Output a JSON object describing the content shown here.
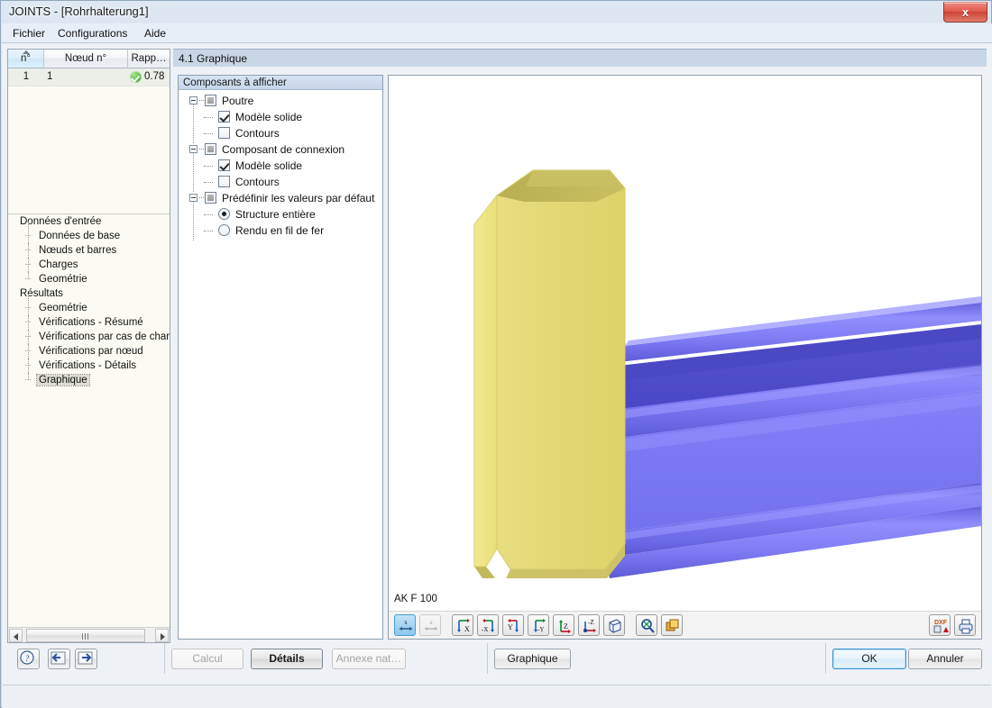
{
  "window": {
    "title": "JOINTS - [Rohrhalterung1]",
    "close_label": "x"
  },
  "menubar": {
    "items": [
      {
        "label": "Fichier"
      },
      {
        "label": "Configurations"
      },
      {
        "label": "Aide"
      }
    ]
  },
  "left_panel": {
    "grid": {
      "columns": [
        "n°",
        "Nœud n°",
        "Rapp…"
      ],
      "rows": [
        {
          "no": "1",
          "node": "1",
          "status": "ok",
          "ratio": "0.78"
        }
      ]
    },
    "nav": {
      "items": [
        {
          "label": "Données d'entrée",
          "level": 0,
          "selected": false
        },
        {
          "label": "Données de base",
          "level": 1,
          "selected": false
        },
        {
          "label": "Nœuds et barres",
          "level": 1,
          "selected": false
        },
        {
          "label": "Charges",
          "level": 1,
          "selected": false
        },
        {
          "label": "Geométrie",
          "level": 1,
          "selected": false
        },
        {
          "label": "Résultats",
          "level": 0,
          "selected": false
        },
        {
          "label": "Geométrie",
          "level": 1,
          "selected": false
        },
        {
          "label": "Vérifications - Résumé",
          "level": 1,
          "selected": false
        },
        {
          "label": "Vérifications par cas de charge",
          "level": 1,
          "selected": false
        },
        {
          "label": "Vérifications par nœud",
          "level": 1,
          "selected": false
        },
        {
          "label": "Vérifications - Détails",
          "level": 1,
          "selected": false
        },
        {
          "label": "Graphique",
          "level": 1,
          "selected": true
        }
      ]
    }
  },
  "section": {
    "header": "4.1 Graphique"
  },
  "components": {
    "title": "Composants à afficher",
    "nodes": [
      {
        "label": "Poutre",
        "type": "tristate",
        "checked": "partial",
        "level": 0
      },
      {
        "label": "Modèle solide",
        "type": "checkbox",
        "checked": true,
        "level": 1
      },
      {
        "label": "Contours",
        "type": "checkbox",
        "checked": false,
        "level": 1
      },
      {
        "label": "Composant de connexion",
        "type": "tristate",
        "checked": "partial",
        "level": 0
      },
      {
        "label": "Modèle solide",
        "type": "checkbox",
        "checked": true,
        "level": 1
      },
      {
        "label": "Contours",
        "type": "checkbox",
        "checked": false,
        "level": 1
      },
      {
        "label": "Prédéfinir les valeurs par défaut",
        "type": "tristate",
        "checked": "partial",
        "level": 0
      },
      {
        "label": "Structure entière",
        "type": "radio",
        "checked": true,
        "level": 1
      },
      {
        "label": "Rendu en fil de fer",
        "type": "radio",
        "checked": false,
        "level": 1
      }
    ]
  },
  "viewport": {
    "label": "AK F 100",
    "toolbar": [
      {
        "name": "dimension-x-toggle",
        "glyph": "x",
        "active": true,
        "disabled": false
      },
      {
        "name": "annotation-toggle",
        "glyph": "a",
        "active": false,
        "disabled": true
      },
      {
        "name": "view-x",
        "glyph": "X",
        "active": false,
        "disabled": false
      },
      {
        "name": "view-minus-x",
        "glyph": "-X",
        "active": false,
        "disabled": false
      },
      {
        "name": "view-y",
        "glyph": "Y",
        "active": false,
        "disabled": false
      },
      {
        "name": "view-minus-y",
        "glyph": "-Y",
        "active": false,
        "disabled": false
      },
      {
        "name": "view-z",
        "glyph": "Z",
        "active": false,
        "disabled": false
      },
      {
        "name": "view-minus-z",
        "glyph": "-Z",
        "active": false,
        "disabled": false
      },
      {
        "name": "view-isometric",
        "glyph": "cube",
        "active": false,
        "disabled": false
      },
      {
        "name": "zoom-reset",
        "glyph": "zoom",
        "active": false,
        "disabled": false
      },
      {
        "name": "layers",
        "glyph": "layers",
        "active": false,
        "disabled": false
      }
    ],
    "toolbar_right": [
      {
        "name": "export-dxf",
        "glyph": "DXF"
      },
      {
        "name": "print",
        "glyph": "printer"
      }
    ]
  },
  "bottom": {
    "help_icon": "help-icon",
    "prev_icon": "previous-icon",
    "next_icon": "next-icon",
    "buttons": [
      {
        "label": "Calcul",
        "state": "disabled"
      },
      {
        "label": "Détails",
        "state": "strong"
      },
      {
        "label": "Annexe nat…",
        "state": "disabled"
      },
      {
        "label": "Graphique",
        "state": "normal"
      },
      {
        "label": "OK",
        "state": "default"
      },
      {
        "label": "Annuler",
        "state": "normal"
      }
    ]
  },
  "colors": {
    "plate": "#e3d870",
    "beam": "#7b78f0",
    "accent": "#3c93d6",
    "status_ok": "#4caf3f"
  }
}
